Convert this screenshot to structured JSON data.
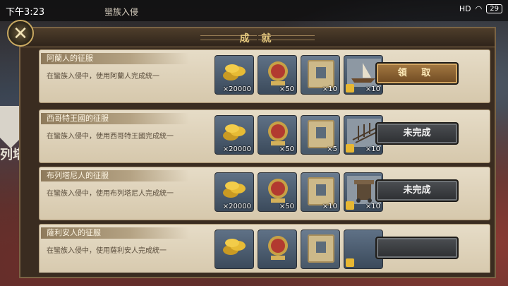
{
  "status_bar": {
    "time": "下午3:23",
    "battery": "29",
    "signal": "HD"
  },
  "map_region": "蠻族入侵",
  "side_text": "列塔",
  "panel": {
    "title": "成 就"
  },
  "achievements": [
    {
      "title": "阿蘭人的征服",
      "desc": "在蠻族入侵中，使用阿蘭人完成統一",
      "rewards": [
        "×20000",
        "×50",
        "×10",
        "×10"
      ],
      "unit": "ship",
      "button": "領 取",
      "state": "claim"
    },
    {
      "title": "西哥特王國的征服",
      "desc": "在蠻族入侵中，使用西哥特王國完成統一",
      "rewards": [
        "×20000",
        "×50",
        "×5",
        "×10"
      ],
      "unit": "archers",
      "button": "未完成",
      "state": "incomplete"
    },
    {
      "title": "布列塔尼人的征服",
      "desc": "在蠻族入侵中，使用布列塔尼人完成統一",
      "rewards": [
        "×20000",
        "×50",
        "×10",
        "×10"
      ],
      "unit": "siege",
      "button": "未完成",
      "state": "incomplete"
    },
    {
      "title": "薩利安人的征服",
      "desc": "在蠻族入侵中，使用薩利安人完成統一",
      "rewards": [
        "",
        "",
        "",
        ""
      ],
      "unit": "",
      "button": "",
      "state": "incomplete"
    }
  ],
  "icons": {
    "close": "close-icon",
    "coin": "gold-coins-icon",
    "medal": "medal-icon",
    "scroll": "map-scroll-icon",
    "unit": "unit-card-icon",
    "piece": "puzzle-piece-icon"
  },
  "colors": {
    "claim_button": "#8a6233",
    "incomplete_button": "#3d4043",
    "title_gold": "#e5c97f"
  }
}
